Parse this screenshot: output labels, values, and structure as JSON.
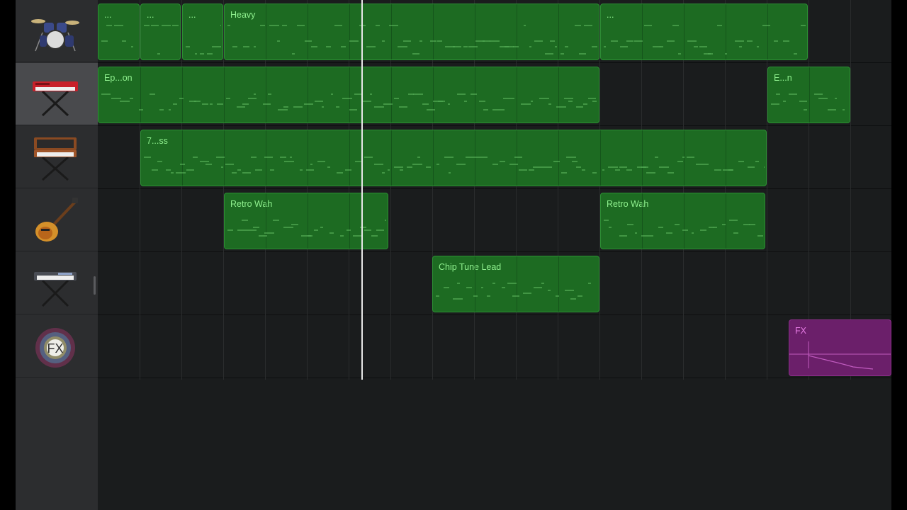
{
  "tracks": [
    {
      "id": "drums",
      "icon": "drum-kit-icon",
      "selected": false
    },
    {
      "id": "synth-keys",
      "icon": "red-keyboard-icon",
      "selected": true
    },
    {
      "id": "analog-synth",
      "icon": "vintage-synth-icon",
      "selected": false
    },
    {
      "id": "guitar",
      "icon": "electric-guitar-icon",
      "selected": false
    },
    {
      "id": "keyboard",
      "icon": "keyboard-stand-icon",
      "selected": false
    },
    {
      "id": "fx",
      "icon": "fx-burst-icon",
      "icon_label": "FX",
      "selected": false
    }
  ],
  "regions": {
    "r1": "...",
    "r2": "...",
    "r3": "...",
    "r4": "Heavy",
    "r5": "...",
    "r6": "Ep...on",
    "r7": "E...n",
    "r8": "7...ss",
    "r9": "Retro Wah",
    "r10": "Retro Wah",
    "r11": "Chip Tune Lead",
    "r12": "FX"
  },
  "colors": {
    "region_green": "#1d6b22",
    "region_text": "#8ff08e",
    "fx_region": "#6b1f6a",
    "fx_text": "#e47ae3",
    "playhead": "#e8e8e8"
  }
}
